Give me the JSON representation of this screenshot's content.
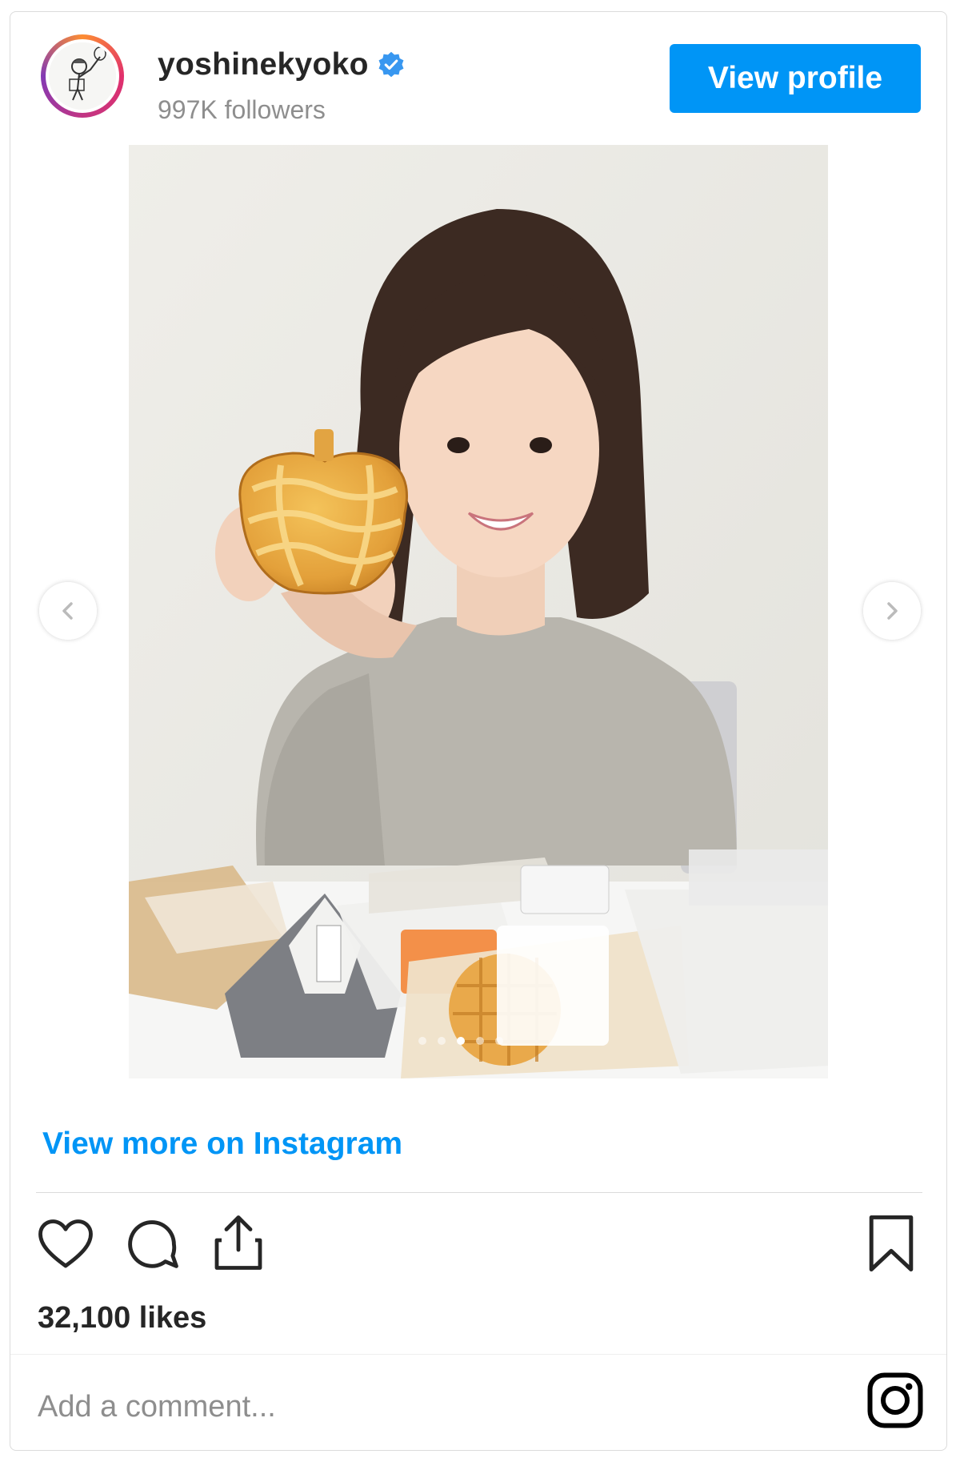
{
  "header": {
    "username": "yoshinekyoko",
    "verified": true,
    "followers": "997K followers",
    "view_profile_label": "View profile"
  },
  "post": {
    "image_alt": "Woman smiling holding an apple-shaped pastry with packaged convenience store foods on the table",
    "carousel": {
      "count": 5,
      "active_index": 2
    },
    "view_more_label": "View more on Instagram",
    "likes": "32,100 likes"
  },
  "comment": {
    "placeholder": "Add a comment..."
  },
  "icons": {
    "verified": "verified-badge-icon",
    "prev": "chevron-left-icon",
    "next": "chevron-right-icon",
    "like": "heart-icon",
    "comment": "comment-bubble-icon",
    "share": "share-icon",
    "save": "bookmark-icon",
    "instagram": "instagram-logo-icon"
  },
  "colors": {
    "accent": "#0095f6",
    "text": "#262626",
    "muted": "#8e8e8e",
    "border": "#dbdbdb"
  }
}
